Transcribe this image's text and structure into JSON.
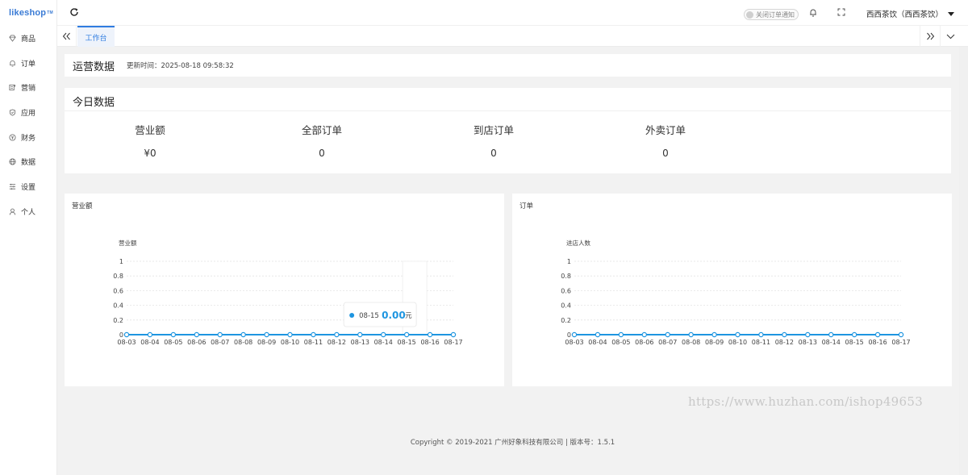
{
  "app": {
    "logo": "likeshop",
    "logo_tm": "TM"
  },
  "sidebar": {
    "items": [
      {
        "label": "商品",
        "icon": "diamond-icon"
      },
      {
        "label": "订单",
        "icon": "bell-icon"
      },
      {
        "label": "营销",
        "icon": "marketing-icon"
      },
      {
        "label": "应用",
        "icon": "shield-icon"
      },
      {
        "label": "财务",
        "icon": "finance-icon"
      },
      {
        "label": "数据",
        "icon": "globe-icon"
      },
      {
        "label": "设置",
        "icon": "list-settings-icon"
      },
      {
        "label": "个人",
        "icon": "user-icon"
      }
    ]
  },
  "header": {
    "order_notice_toggle": "关闭订单通知",
    "store_name": "西西茶饮（西西茶饮）"
  },
  "tabs": {
    "active": "工作台"
  },
  "operations": {
    "title": "运营数据",
    "updated": "更新时间：2025-08-18 09:58:32"
  },
  "today": {
    "title": "今日数据",
    "metrics": [
      {
        "label": "营业额",
        "value": "¥0"
      },
      {
        "label": "全部订单",
        "value": "0"
      },
      {
        "label": "到店订单",
        "value": "0"
      },
      {
        "label": "外卖订单",
        "value": "0"
      }
    ]
  },
  "chart_data": [
    {
      "type": "line",
      "title": "营业额",
      "ylabel": "营业额",
      "x": [
        "08-03",
        "08-04",
        "08-05",
        "08-06",
        "08-07",
        "08-08",
        "08-09",
        "08-10",
        "08-11",
        "08-12",
        "08-13",
        "08-14",
        "08-15",
        "08-16",
        "08-17"
      ],
      "series": [
        {
          "values": [
            0,
            0,
            0,
            0,
            0,
            0,
            0,
            0,
            0,
            0,
            0,
            0,
            0,
            0,
            0
          ]
        }
      ],
      "ylim": [
        0,
        1
      ],
      "yticks": [
        "0",
        "0.2",
        "0.4",
        "0.6",
        "0.8",
        "1"
      ],
      "grid": true,
      "color": "#1e95e0",
      "tooltip": {
        "x": "08-15",
        "value": "0.00",
        "unit": "元"
      }
    },
    {
      "type": "line",
      "title": "订单",
      "ylabel": "进店人数",
      "x": [
        "08-03",
        "08-04",
        "08-05",
        "08-06",
        "08-07",
        "08-08",
        "08-09",
        "08-10",
        "08-11",
        "08-12",
        "08-13",
        "08-14",
        "08-15",
        "08-16",
        "08-17"
      ],
      "series": [
        {
          "values": [
            0,
            0,
            0,
            0,
            0,
            0,
            0,
            0,
            0,
            0,
            0,
            0,
            0,
            0,
            0
          ]
        }
      ],
      "ylim": [
        0,
        1
      ],
      "yticks": [
        "0",
        "0.2",
        "0.4",
        "0.6",
        "0.8",
        "1"
      ],
      "grid": true,
      "color": "#1e95e0"
    }
  ],
  "watermark": "https://www.huzhan.com/ishop49653",
  "footer": "Copyright © 2019-2021 广州好象科技有限公司 | 版本号：1.5.1"
}
